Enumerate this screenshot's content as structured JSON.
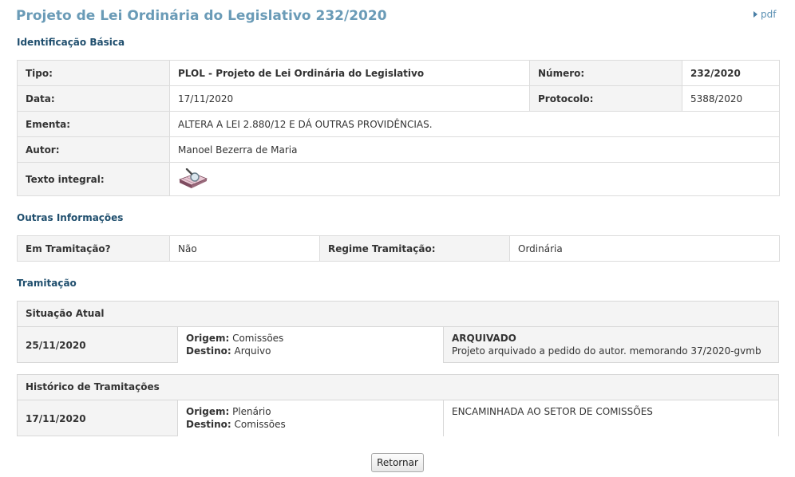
{
  "page": {
    "title": "Projeto de Lei Ordinária do Legislativo 232/2020",
    "pdf_label": "pdf"
  },
  "identificacao": {
    "heading": "Identificação Básica",
    "tipo_label": "Tipo:",
    "tipo_value": "PLOL - Projeto de Lei Ordinária do Legislativo",
    "numero_label": "Número:",
    "numero_value": "232/2020",
    "data_label": "Data:",
    "data_value": "17/11/2020",
    "protocolo_label": "Protocolo:",
    "protocolo_value": "5388/2020",
    "ementa_label": "Ementa:",
    "ementa_value": "ALTERA A LEI 2.880/12 E DÁ OUTRAS PROVIDÊNCIAS.",
    "autor_label": "Autor:",
    "autor_value": "Manoel Bezerra de Maria",
    "texto_label": "Texto integral:",
    "texto_icon": "book-search-icon"
  },
  "outras": {
    "heading": "Outras Informações",
    "tramitacao_label": "Em Tramitação?",
    "tramitacao_value": "Não",
    "regime_label": "Regime Tramitação:",
    "regime_value": "Ordinária"
  },
  "tramitacao": {
    "heading": "Tramitação",
    "atual": {
      "heading": "Situação Atual",
      "date": "25/11/2020",
      "origem_label": "Origem:",
      "origem_value": " Comissões",
      "destino_label": "Destino:",
      "destino_value": " Arquivo",
      "status": "ARQUIVADO",
      "description": "Projeto arquivado a pedido do autor. memorando 37/2020-gvmb"
    },
    "historico": {
      "heading": "Histórico de Tramitações",
      "date": "17/11/2020",
      "origem_label": "Origem:",
      "origem_value": " Plenário",
      "destino_label": "Destino:",
      "destino_value": " Comissões",
      "description": "ENCAMINHADA AO SETOR DE COMISSÕES"
    }
  },
  "actions": {
    "retornar_label": "Retornar"
  }
}
